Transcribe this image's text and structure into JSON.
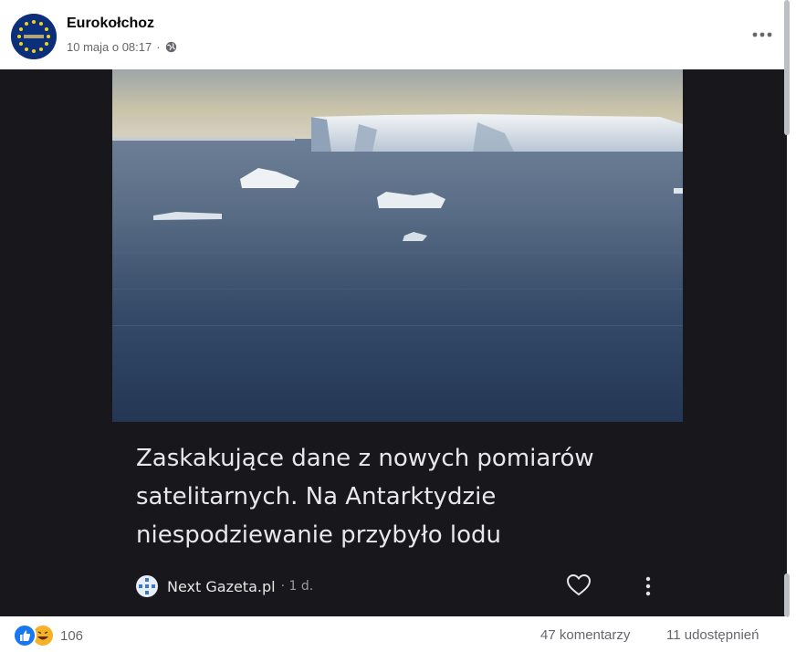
{
  "post": {
    "author": "Eurokołchoz",
    "timestamp": "10 maja o 08:17",
    "separator": "·",
    "privacy_icon": "globe-icon",
    "more_icon": "more-horizontal-icon"
  },
  "card": {
    "title": "Zaskakujące dane z nowych pomiarów satelitarnych. Na Antarktydzie niespodziewanie przybyło lodu",
    "source_name": "Next Gazeta.pl",
    "source_age": "· 1 d.",
    "heart_icon": "heart-outline-icon",
    "menu_icon": "more-vertical-icon"
  },
  "footer": {
    "reaction_count": "106",
    "comments": "47 komentarzy",
    "shares": "11 udostępnień"
  },
  "colors": {
    "media_background": "#18181c",
    "like_blue": "#1877f2",
    "haha_yellow": "#f7b125",
    "meta_gray": "#65676b"
  }
}
